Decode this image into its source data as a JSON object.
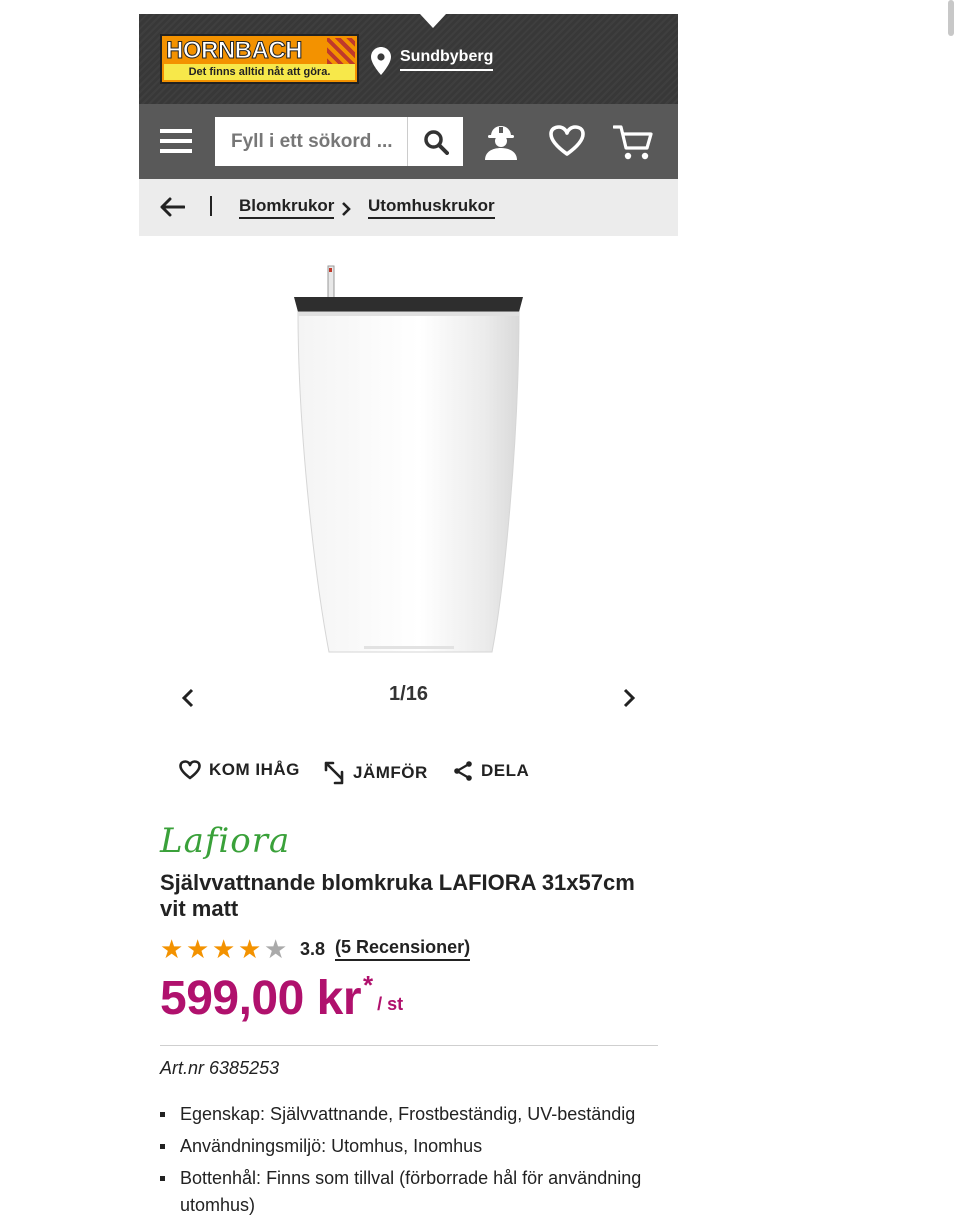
{
  "header": {
    "logo_name": "HORNBACH",
    "logo_slogan": "Det finns alltid nåt att göra.",
    "store": "Sundbyberg",
    "search_placeholder": "Fyll i ett sökord ..."
  },
  "breadcrumb": {
    "items": [
      "Blomkrukor",
      "Utomhuskrukor"
    ]
  },
  "gallery": {
    "counter": "1/16"
  },
  "actions": {
    "remember": "KOM IHÅG",
    "compare": "JÄMFÖR",
    "share": "DELA"
  },
  "product": {
    "brand": "Lafiora",
    "title": "Självvattnande blomkruka LAFIORA 31x57cm vit matt",
    "rating": "3.8",
    "rating_value": 3.8,
    "reviews": "(5 Recensioner)",
    "price": "599,00 kr",
    "price_asterisk": "*",
    "unit": "/ st",
    "artnr_label": "Art.nr",
    "artnr": "6385253",
    "features": [
      "Egenskap: Självvattnande, Frostbeständig, UV-beständig",
      "Användningsmiljö: Utomhus, Inomhus",
      "Bottenhål: Finns som tillval (förborrade hål för användning utomhus)"
    ]
  },
  "colors": {
    "brand_orange": "#f39200",
    "price_magenta": "#b0116d",
    "header_dark": "#3a3a3a",
    "header_bar": "#595959",
    "brand_green": "#3aa13a"
  }
}
